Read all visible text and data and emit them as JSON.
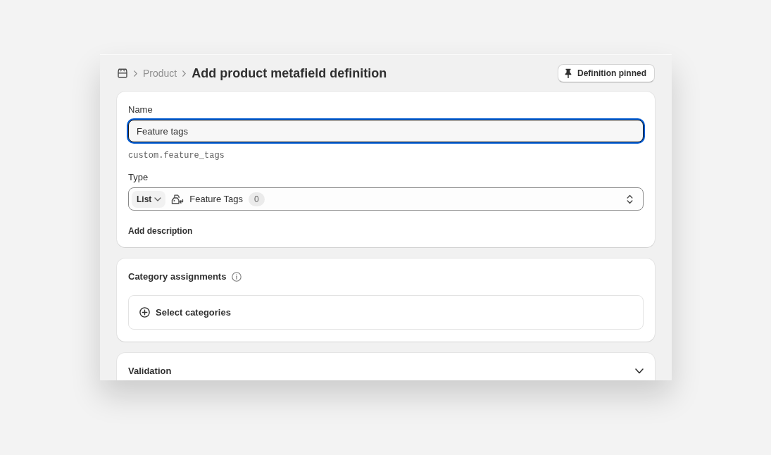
{
  "breadcrumb": {
    "items": [
      {
        "label": "Product"
      }
    ],
    "title": "Add product metafield definition"
  },
  "pin_button": {
    "label": "Definition pinned"
  },
  "definition_card": {
    "name_field": {
      "label": "Name",
      "value": "Feature tags",
      "focused": true
    },
    "key": "custom.feature_tags",
    "type_field": {
      "label": "Type",
      "list_toggle": "List",
      "type_name": "Feature Tags",
      "count": "0"
    },
    "add_description": "Add description"
  },
  "category_card": {
    "title": "Category assignments",
    "select_button": "Select categories"
  },
  "validation_card": {
    "title": "Validation",
    "expanded": false
  }
}
